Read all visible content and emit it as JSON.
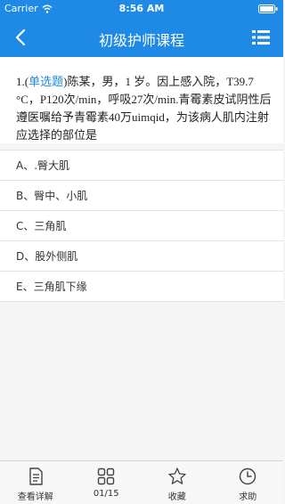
{
  "status_bar": {
    "carrier": "Carrier",
    "time": "8:56 AM"
  },
  "nav": {
    "title": "初级护师课程",
    "back_icon": "chevron-left-icon",
    "menu_icon": "list-menu-icon"
  },
  "question": {
    "number": "1.(",
    "type": "单选题",
    "body": ")陈某，男，1 岁。因上感入院，T39.7 °C，P120次/min，呼吸27次/min.青霉素皮试阴性后遵医嘱给予青霉素40万uimqid，为该病人肌内注射应选择的部位是"
  },
  "options": [
    {
      "label": "A、.臀大肌"
    },
    {
      "label": "B、臀中、小肌"
    },
    {
      "label": "C、三角肌"
    },
    {
      "label": "D、股外侧肌"
    },
    {
      "label": "E、三角肌下缘"
    }
  ],
  "toolbar": {
    "details_label": "查看详解",
    "progress_label": "01/15",
    "favorite_label": "收藏",
    "help_label": "求助"
  },
  "colors": {
    "accent": "#1e8ae6",
    "background": "#f5f5f5"
  }
}
